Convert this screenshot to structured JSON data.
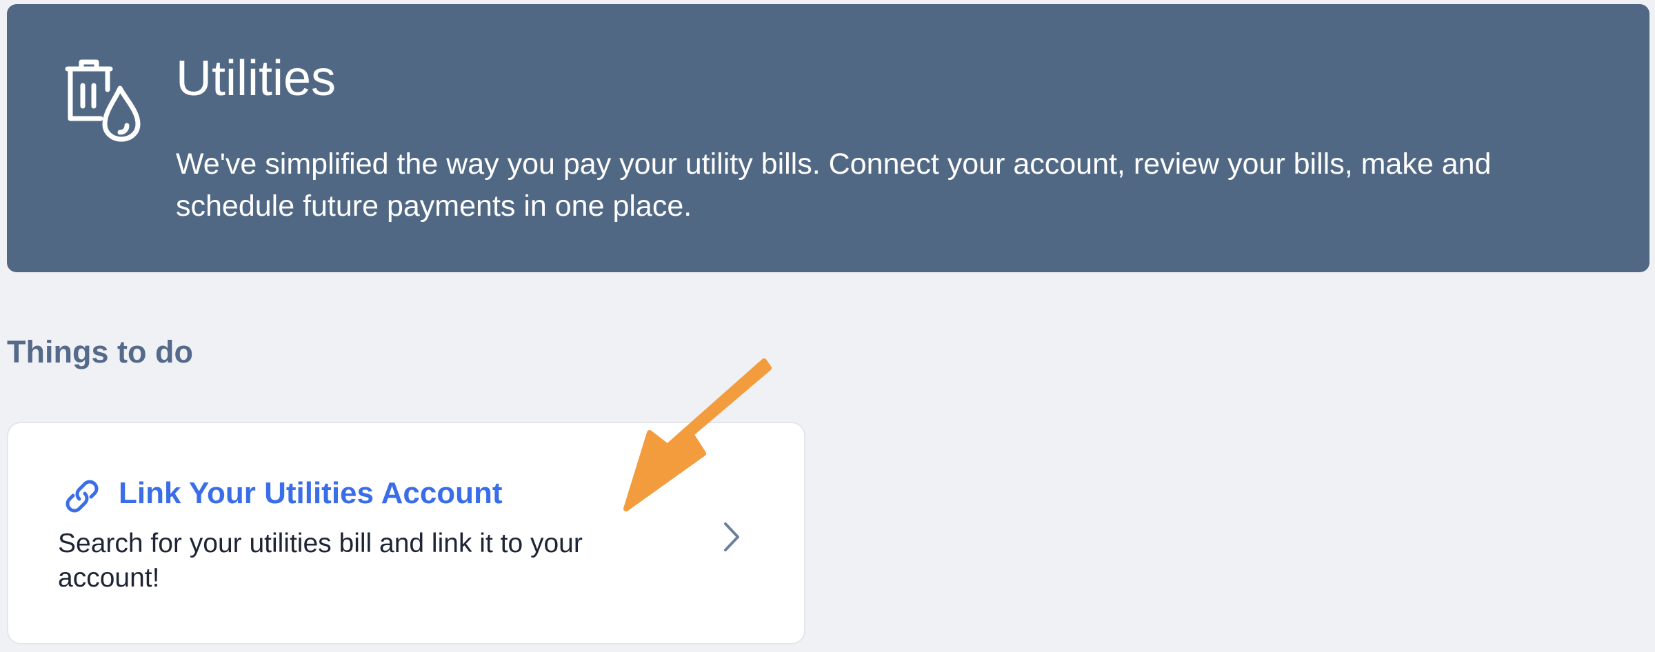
{
  "banner": {
    "icon": "utilities-trash-water-drop-icon",
    "title": "Utilities",
    "description": "We've simplified the way you pay your utility bills. Connect your account, review your bills, make and schedule future payments in one place."
  },
  "things_to_do": {
    "heading": "Things to do",
    "items": [
      {
        "icon": "link-icon",
        "title": "Link Your Utilities Account",
        "description": "Search for your utilities bill and link it to your account!",
        "action_icon": "chevron-right-icon"
      }
    ]
  },
  "annotation": {
    "icon": "orange-arrow-icon",
    "color": "#f39c3d"
  },
  "colors": {
    "banner_bg": "#506884",
    "page_bg": "#f0f1f5",
    "accent": "#3a6ee8",
    "section_heading": "#55698a"
  }
}
